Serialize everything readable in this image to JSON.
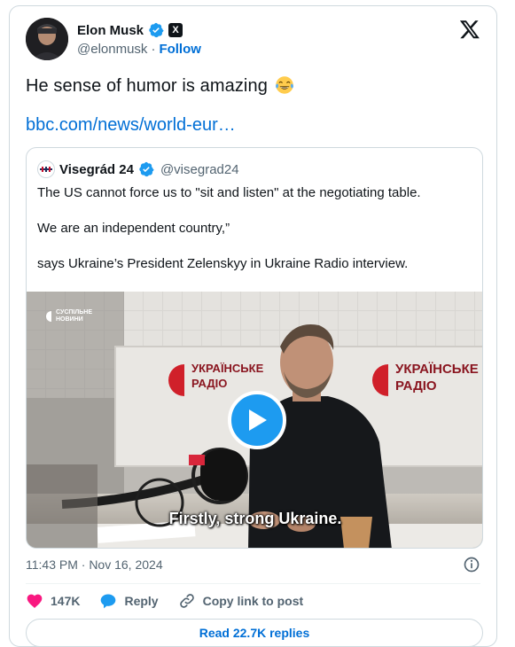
{
  "author": {
    "name": "Elon Musk",
    "handle": "@elonmusk",
    "separator": "·",
    "follow_label": "Follow",
    "x_badge": "X"
  },
  "tweet": {
    "text": "He sense of humor is amazing",
    "emoji": "face-with-tears-of-joy",
    "link_text": "bbc.com/news/world-eur…"
  },
  "quote": {
    "name": "Visegrád 24",
    "handle": "@visegrad24",
    "line1": "The US cannot force us to \"sit and listen\" at the negotiating table.",
    "line2": "We are an independent country,”",
    "line3": "says Ukraine’s President Zelenskyy in Ukraine Radio interview.",
    "media": {
      "channel_logo_line1": "СУСПІЛЬНЕ",
      "channel_logo_line2": "НОВИНИ",
      "wall_sign_line1": "УКРАЇНСЬКЕ",
      "wall_sign_line2": "РАДІО",
      "subtitle": "Firstly, strong Ukraine."
    }
  },
  "footer": {
    "timestamp": "11:43 PM · Nov 16, 2024",
    "likes": "147K",
    "reply_label": "Reply",
    "copy_label": "Copy link to post",
    "read_replies": "Read 22.7K replies"
  },
  "colors": {
    "accent": "#1d9bf0",
    "link": "#006fd6",
    "like": "#f91880",
    "text": "#0f1419",
    "muted": "#536471"
  }
}
